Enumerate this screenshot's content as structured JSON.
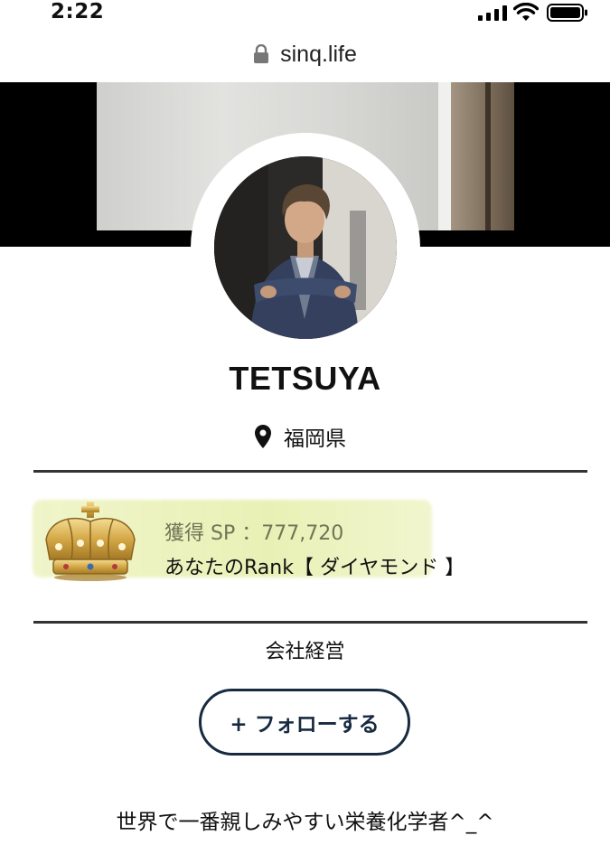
{
  "status_bar": {
    "time": "2:22",
    "icons": [
      "signal-icon",
      "wifi-icon",
      "battery-icon"
    ]
  },
  "browser": {
    "url": "sinq.life",
    "lock_icon": "lock-icon"
  },
  "profile": {
    "name": "TETSUYA",
    "location_icon": "map-pin-icon",
    "location": "福岡県",
    "points_text": "獲得 SP ：777,720",
    "rank_text": "あなたのRank【 ダイヤモンド 】",
    "rank_icon": "crown-icon",
    "occupation": "会社経営",
    "follow_button": "+ フォローする",
    "bio": "世界で一番親しみやすい栄養化学者^_^"
  },
  "colors": {
    "button_navy": "#172a3f",
    "highlight": "#e8f0b2",
    "divider": "#333333"
  }
}
